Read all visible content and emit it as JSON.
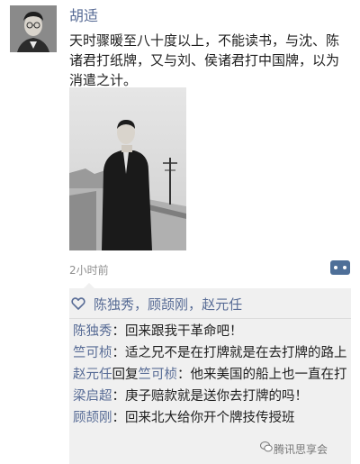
{
  "post": {
    "author": "胡适",
    "text": "天时骤暖至八十度以上，不能读书，与沈、陈诸君打纸牌，又与刘、侯诸君打中国牌，以为消遣之计。",
    "time": "2小时前"
  },
  "likes": {
    "names": [
      "陈独秀",
      "顾颉刚",
      "赵元任"
    ],
    "separator": "，"
  },
  "comments": [
    {
      "name": "陈独秀",
      "reply_label": "",
      "reply_to": "",
      "text": "：回来跟我干革命吧！"
    },
    {
      "name": "竺可桢",
      "reply_label": "",
      "reply_to": "",
      "text": "：适之兄不是在打牌就是在去打牌的路上"
    },
    {
      "name": "赵元任",
      "reply_label": "回复",
      "reply_to": "竺可桢",
      "text": "：他来美国的船上也一直在打"
    },
    {
      "name": "梁启超",
      "reply_label": "",
      "reply_to": "",
      "text": "：庚子赔款就是送你去打牌的吗！"
    },
    {
      "name": "顾颉刚",
      "reply_label": "",
      "reply_to": "",
      "text": "：回来北大给你开个牌技传授班"
    }
  ],
  "watermark": "腾讯思享会",
  "colors": {
    "link": "#576b95",
    "panel": "#f0f0f0",
    "button": "#4e6f98"
  },
  "icons": {
    "more": "more-dots-icon",
    "like": "heart-outline-icon",
    "watermark": "wechat-icon"
  }
}
